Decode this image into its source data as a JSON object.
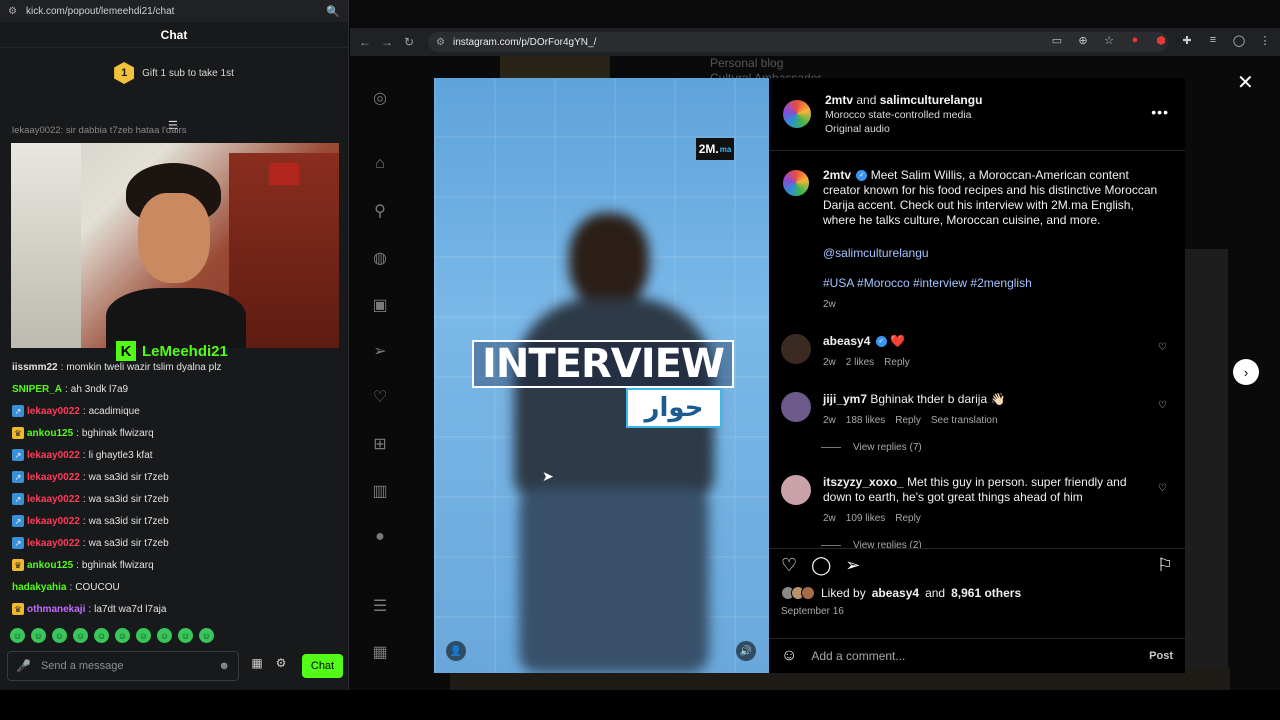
{
  "kick": {
    "url": "kick.com/popout/lemeehdi21/chat",
    "title": "Chat",
    "gift_num": "1",
    "gift_text": "Gift 1 sub to take 1st",
    "cut_text": "lekaay0022: sir dabbia t7zeb hataa l'dairs",
    "streamer": "LeMeehdi21",
    "messages": [
      {
        "user": "iissmm22",
        "text": "momkin tweli wazir tslim dyalna plz",
        "color": "#e2e2e2",
        "badge": ""
      },
      {
        "user": "SNIPER_A",
        "text": "ah 3ndk l7a9",
        "color": "#53fc18",
        "badge": ""
      },
      {
        "user": "lekaay0022",
        "text": "acadimique",
        "color": "#ff3b5c",
        "badge": "sub"
      },
      {
        "user": "ankou125",
        "text": "bghinak flwizarq",
        "color": "#53fc18",
        "badge": "crown"
      },
      {
        "user": "lekaay0022",
        "text": "li ghaytle3 kfat",
        "color": "#ff3b5c",
        "badge": "sub"
      },
      {
        "user": "lekaay0022",
        "text": "wa sa3id sir t7zeb",
        "color": "#ff3b5c",
        "badge": "sub"
      },
      {
        "user": "lekaay0022",
        "text": "wa sa3id sir t7zeb",
        "color": "#ff3b5c",
        "badge": "sub"
      },
      {
        "user": "lekaay0022",
        "text": "wa sa3id sir t7zeb",
        "color": "#ff3b5c",
        "badge": "sub"
      },
      {
        "user": "lekaay0022",
        "text": "wa sa3id sir t7zeb",
        "color": "#ff3b5c",
        "badge": "sub"
      },
      {
        "user": "ankou125",
        "text": "bghinak flwizarq",
        "color": "#53fc18",
        "badge": "crown"
      },
      {
        "user": "hadakyahia",
        "text": "COUCOU",
        "color": "#53fc18",
        "badge": ""
      },
      {
        "user": "othmanekaji",
        "text": "la7dt wa7d l7aja",
        "color": "#c26bff",
        "badge": "crown"
      }
    ],
    "send_placeholder": "Send a message",
    "chat_button": "Chat",
    "accent": "#53fc18"
  },
  "browser": {
    "url": "instagram.com/p/DOrFor4gYN_/"
  },
  "instagram": {
    "bg_text_1": "Personal blog",
    "bg_text_2": "Cultural Ambassador",
    "video": {
      "logo": "2M",
      "logo_suffix": "ma",
      "overlay_title": "INTERVIEW",
      "overlay_arabic": "حوار"
    },
    "header": {
      "user1": "2mtv",
      "and": "and",
      "user2": "salimculturelangu",
      "line2": "Morocco state-controlled media",
      "line3": "Original audio"
    },
    "caption": {
      "user": "2mtv",
      "text": "Meet Salim Willis, a Moroccan-American content creator known for his food recipes and his distinctive Moroccan Darija accent. Check out his interview with 2M.ma English, where he talks culture, Moroccan cuisine, and more.",
      "mention": "@salimculturelangu",
      "tags": "#USA #Morocco #interview #2menglish",
      "age": "2w"
    },
    "comments": [
      {
        "user": "abeasy4",
        "text": "❤️",
        "age": "2w",
        "likes": "2 likes",
        "reply": "Reply",
        "extra": "",
        "avatar": "#3a2a22"
      },
      {
        "user": "jiji_ym7",
        "text": "Bghinak thder b darija 👋🏻",
        "age": "2w",
        "likes": "188 likes",
        "reply": "Reply",
        "extra": "See translation",
        "avatar": "#6b5a8a"
      },
      {
        "user": "itszyzy_xoxo_",
        "text": "Met this guy in person. super friendly and down to earth, he's got great things ahead of him",
        "age": "2w",
        "likes": "109 likes",
        "reply": "Reply",
        "extra": "",
        "avatar": "#c9a1a8"
      }
    ],
    "view_replies_1": "View replies (7)",
    "view_replies_2": "View replies (2)",
    "liked_by": "Liked by",
    "liked_user": "abeasy4",
    "liked_and": "and",
    "liked_others": "8,961 others",
    "date": "September 16",
    "comment_placeholder": "Add a comment...",
    "post_label": "Post"
  }
}
